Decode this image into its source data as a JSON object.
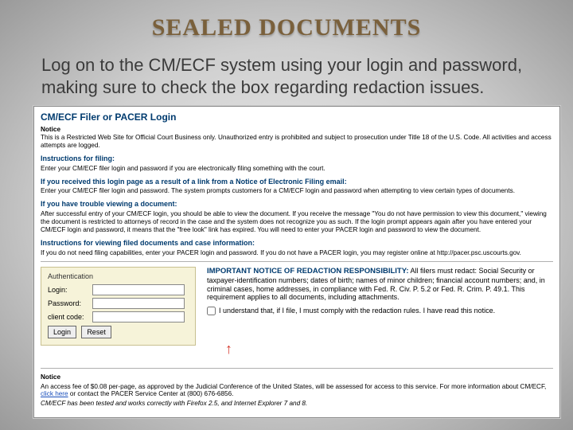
{
  "title": "SEALED DOCUMENTS",
  "intro": "Log on to the CM/ECF  system using your login and password, making sure to check the box regarding redaction issues.",
  "screenshot": {
    "heading": "CM/ECF Filer or PACER Login",
    "notice_label": "Notice",
    "notice_body": "This is a Restricted Web Site for Official Court Business only. Unauthorized entry is prohibited and subject to prosecution under Title 18 of the U.S. Code. All activities and access attempts are logged.",
    "sections": [
      {
        "title": "Instructions for filing:",
        "body": "Enter your CM/ECF filer login and password if you are electronically filing something with the court."
      },
      {
        "title": "If you received this login page as a result of a link from a Notice of Electronic Filing email:",
        "body": "Enter your CM/ECF filer login and password. The system prompts customers for a CM/ECF login and password when attempting to view certain types of documents."
      },
      {
        "title": "If you have trouble viewing a document:",
        "body": "After successful entry of your CM/ECF login, you should be able to view the document. If you receive the message \"You do not have permission to view this document,\" viewing the document is restricted to attorneys of record in the case and the system does not recognize you as such. If the login prompt appears again after you have entered your CM/ECF login and password, it means that the \"free look\" link has expired. You will need to enter your PACER login and password to view the document."
      },
      {
        "title": "Instructions for viewing filed documents and case information:",
        "body": "If you do not need filing capabilities, enter your PACER login and password. If you do not have a PACER login, you may register online at http://pacer.psc.uscourts.gov."
      }
    ],
    "auth": {
      "legend": "Authentication",
      "login_label": "Login:",
      "password_label": "Password:",
      "client_label": "client code:",
      "login_btn": "Login",
      "reset_btn": "Reset"
    },
    "redaction": {
      "heading": "IMPORTANT NOTICE OF REDACTION RESPONSIBILITY:",
      "body": "All filers must redact: Social Security or taxpayer-identification numbers; dates of birth; names of minor children; financial account numbers; and, in criminal cases, home addresses, in compliance with Fed. R. Civ. P. 5.2 or Fed. R. Crim. P. 49.1. This requirement applies to all documents, including attachments.",
      "ack": "I understand that, if I file, I must comply with the redaction rules. I have read this notice."
    },
    "footer1_prefix": "An access fee of $0.08 per-page, as approved by the Judicial Conference of the United States, will be assessed for access to this service. For more information about CM/ECF, ",
    "footer1_link": "click here",
    "footer1_suffix": " or contact the PACER Service Center at (800) 676-6856.",
    "footer2": "CM/ECF has been tested and works correctly with Firefox 2.5, and Internet Explorer 7 and 8."
  }
}
